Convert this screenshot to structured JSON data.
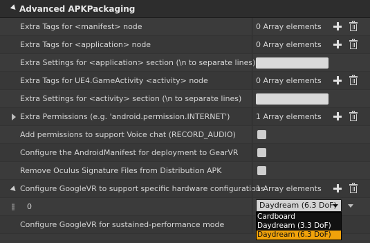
{
  "section_title": "Advanced APKPackaging",
  "rows": [
    {
      "label": "Extra Tags for <manifest> node",
      "value": "0 Array elements"
    },
    {
      "label": "Extra Tags for <application> node",
      "value": "0 Array elements"
    },
    {
      "label": "Extra Settings for <application> section (\\n to separate lines)",
      "value": ""
    },
    {
      "label": "Extra Tags for UE4.GameActivity <activity> node",
      "value": "0 Array elements"
    },
    {
      "label": "Extra Settings for <activity> section (\\n to separate lines)",
      "value": ""
    },
    {
      "label": "Extra Permissions (e.g. 'android.permission.INTERNET')",
      "value": "1 Array elements"
    },
    {
      "label": "Add permissions to support Voice chat (RECORD_AUDIO)",
      "value": ""
    },
    {
      "label": "Configure the AndroidManifest for deployment to GearVR",
      "value": ""
    },
    {
      "label": "Remove Oculus Signature Files from Distribution APK",
      "value": ""
    },
    {
      "label": "Configure GoogleVR to support specific hardware configurations",
      "value": "1 Array elements"
    },
    {
      "label": "0",
      "value": "Daydream (6.3 DoF)"
    },
    {
      "label": "Configure GoogleVR for sustained-performance mode",
      "value": ""
    }
  ],
  "dropdown": {
    "options": [
      "Cardboard",
      "Daydream (3.3 DoF)",
      "Daydream (6.3 DoF)"
    ],
    "selected_index": 2
  },
  "icons": {
    "add": "plus-icon",
    "delete": "trash-icon"
  }
}
